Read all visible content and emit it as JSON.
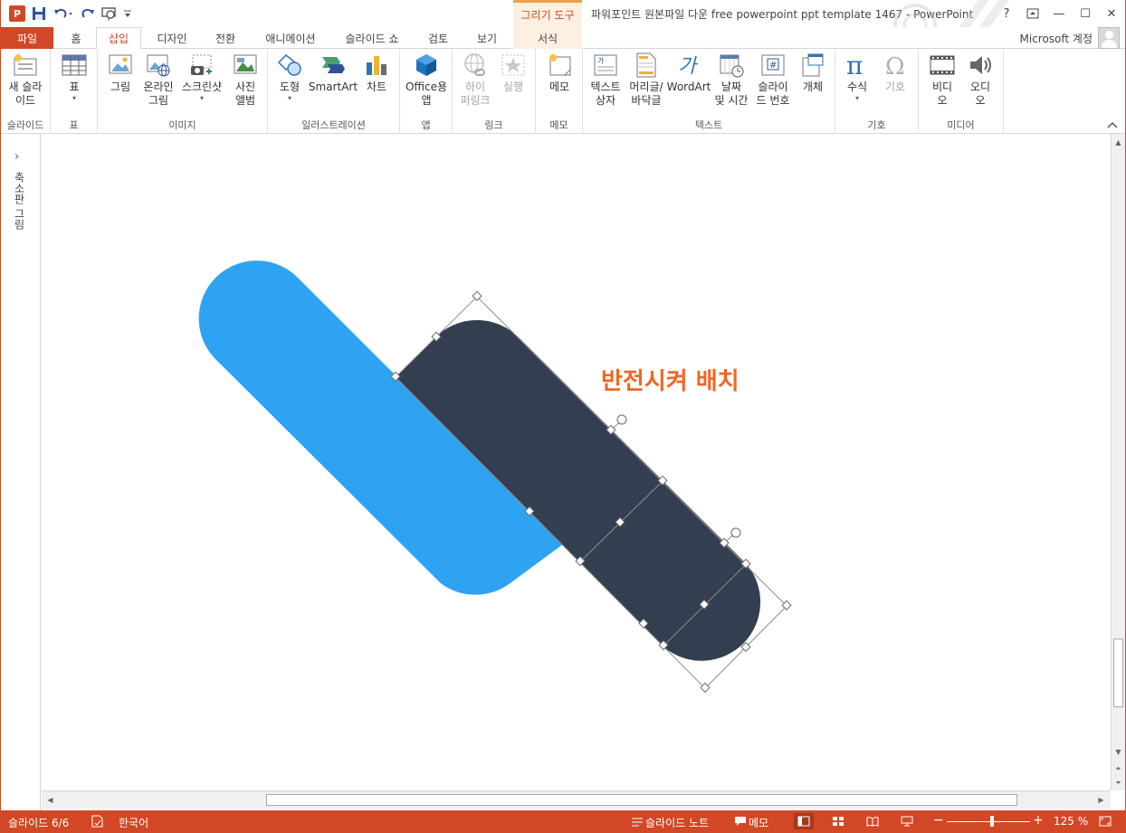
{
  "app": {
    "window_title": "파워포인트 원본파일 다운 free powerpoint ppt template 1467 - PowerPoint",
    "contextual_tab_group": "그리기 도구",
    "account": "Microsoft 계정",
    "accent_color": "#d24726"
  },
  "qat": {
    "icons": [
      "powerpoint-logo-icon",
      "save-icon",
      "undo-icon",
      "redo-icon",
      "slideshow-from-start-icon",
      "customize-qat-icon"
    ]
  },
  "window_controls": {
    "help": "?",
    "ribbon_options": "⊡",
    "minimize": "—",
    "restore": "☐",
    "close": "✕"
  },
  "tabs": [
    {
      "label": "파일"
    },
    {
      "label": "홈"
    },
    {
      "label": "삽입"
    },
    {
      "label": "디자인"
    },
    {
      "label": "전환"
    },
    {
      "label": "애니메이션"
    },
    {
      "label": "슬라이드 쇼"
    },
    {
      "label": "검토"
    },
    {
      "label": "보기"
    },
    {
      "label": "서식"
    }
  ],
  "ribbon": {
    "groups": [
      {
        "label": "슬라이드",
        "buttons": [
          {
            "label": "새 슬라\n이드",
            "icon": "new-slide-icon"
          }
        ]
      },
      {
        "label": "표",
        "buttons": [
          {
            "label": "표",
            "icon": "table-icon"
          }
        ]
      },
      {
        "label": "이미지",
        "buttons": [
          {
            "label": "그림",
            "icon": "picture-icon"
          },
          {
            "label": "온라인\n그림",
            "icon": "online-picture-icon"
          },
          {
            "label": "스크린샷",
            "icon": "screenshot-icon"
          },
          {
            "label": "사진\n앨범",
            "icon": "photo-album-icon"
          }
        ]
      },
      {
        "label": "일러스트레이션",
        "buttons": [
          {
            "label": "도형",
            "icon": "shapes-icon"
          },
          {
            "label": "SmartArt",
            "icon": "smartart-icon"
          },
          {
            "label": "차트",
            "icon": "chart-icon"
          }
        ]
      },
      {
        "label": "앱",
        "buttons": [
          {
            "label": "Office용\n앱",
            "icon": "office-apps-icon"
          }
        ]
      },
      {
        "label": "링크",
        "buttons": [
          {
            "label": "하이\n퍼링크",
            "icon": "hyperlink-icon"
          },
          {
            "label": "실행",
            "icon": "action-icon"
          }
        ]
      },
      {
        "label": "메모",
        "buttons": [
          {
            "label": "메모",
            "icon": "comment-icon"
          }
        ]
      },
      {
        "label": "텍스트",
        "buttons": [
          {
            "label": "텍스트\n상자",
            "icon": "textbox-icon"
          },
          {
            "label": "머리글/\n바닥글",
            "icon": "header-footer-icon"
          },
          {
            "label": "WordArt",
            "icon": "wordart-icon"
          },
          {
            "label": "날짜\n및 시간",
            "icon": "date-time-icon"
          },
          {
            "label": "슬라이\n드 번호",
            "icon": "slide-number-icon"
          },
          {
            "label": "개체",
            "icon": "object-icon"
          }
        ]
      },
      {
        "label": "기호",
        "buttons": [
          {
            "label": "수식",
            "icon": "equation-icon"
          },
          {
            "label": "기호",
            "icon": "symbol-icon"
          }
        ]
      },
      {
        "label": "미디어",
        "buttons": [
          {
            "label": "비디\n오",
            "icon": "video-icon"
          },
          {
            "label": "오디\n오",
            "icon": "audio-icon"
          }
        ]
      }
    ]
  },
  "thumbnail_pane": {
    "label": "축소판 그림"
  },
  "slide": {
    "annotation": "반전시켜 배치",
    "annotation_color": "#f26522",
    "shape_blue_color": "#2ea3f2",
    "shape_dark_color": "#333e50"
  },
  "status": {
    "slide_indicator": "슬라이드 6/6",
    "language": "한국어",
    "notes": "슬라이드 노트",
    "comments": "메모",
    "zoom": "125 %",
    "zoom_level_percent": 125
  }
}
